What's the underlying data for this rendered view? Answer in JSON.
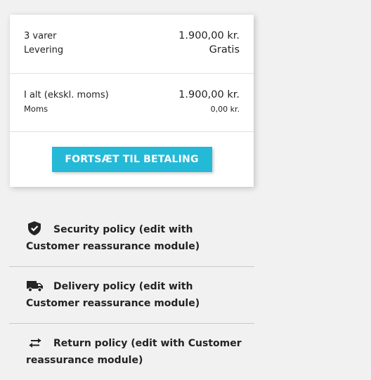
{
  "summary": {
    "items_label": "3 varer",
    "items_value": "1.900,00 kr.",
    "shipping_label": "Levering",
    "shipping_value": "Gratis",
    "total_label": "I alt (ekskl. moms)",
    "total_value": "1.900,00 kr.",
    "tax_label": "Moms",
    "tax_value": "0,00 kr."
  },
  "checkout": {
    "button_label": "FORTSÆT TIL BETALING",
    "button_color": "#24b9d7"
  },
  "reassurance": [
    {
      "icon": "shield-check-icon",
      "text": "Security policy (edit with Customer reassurance module)"
    },
    {
      "icon": "truck-icon",
      "text": "Delivery policy (edit with Customer reassurance module)"
    },
    {
      "icon": "swap-arrows-icon",
      "text": "Return policy (edit with Customer reassurance module)"
    }
  ]
}
